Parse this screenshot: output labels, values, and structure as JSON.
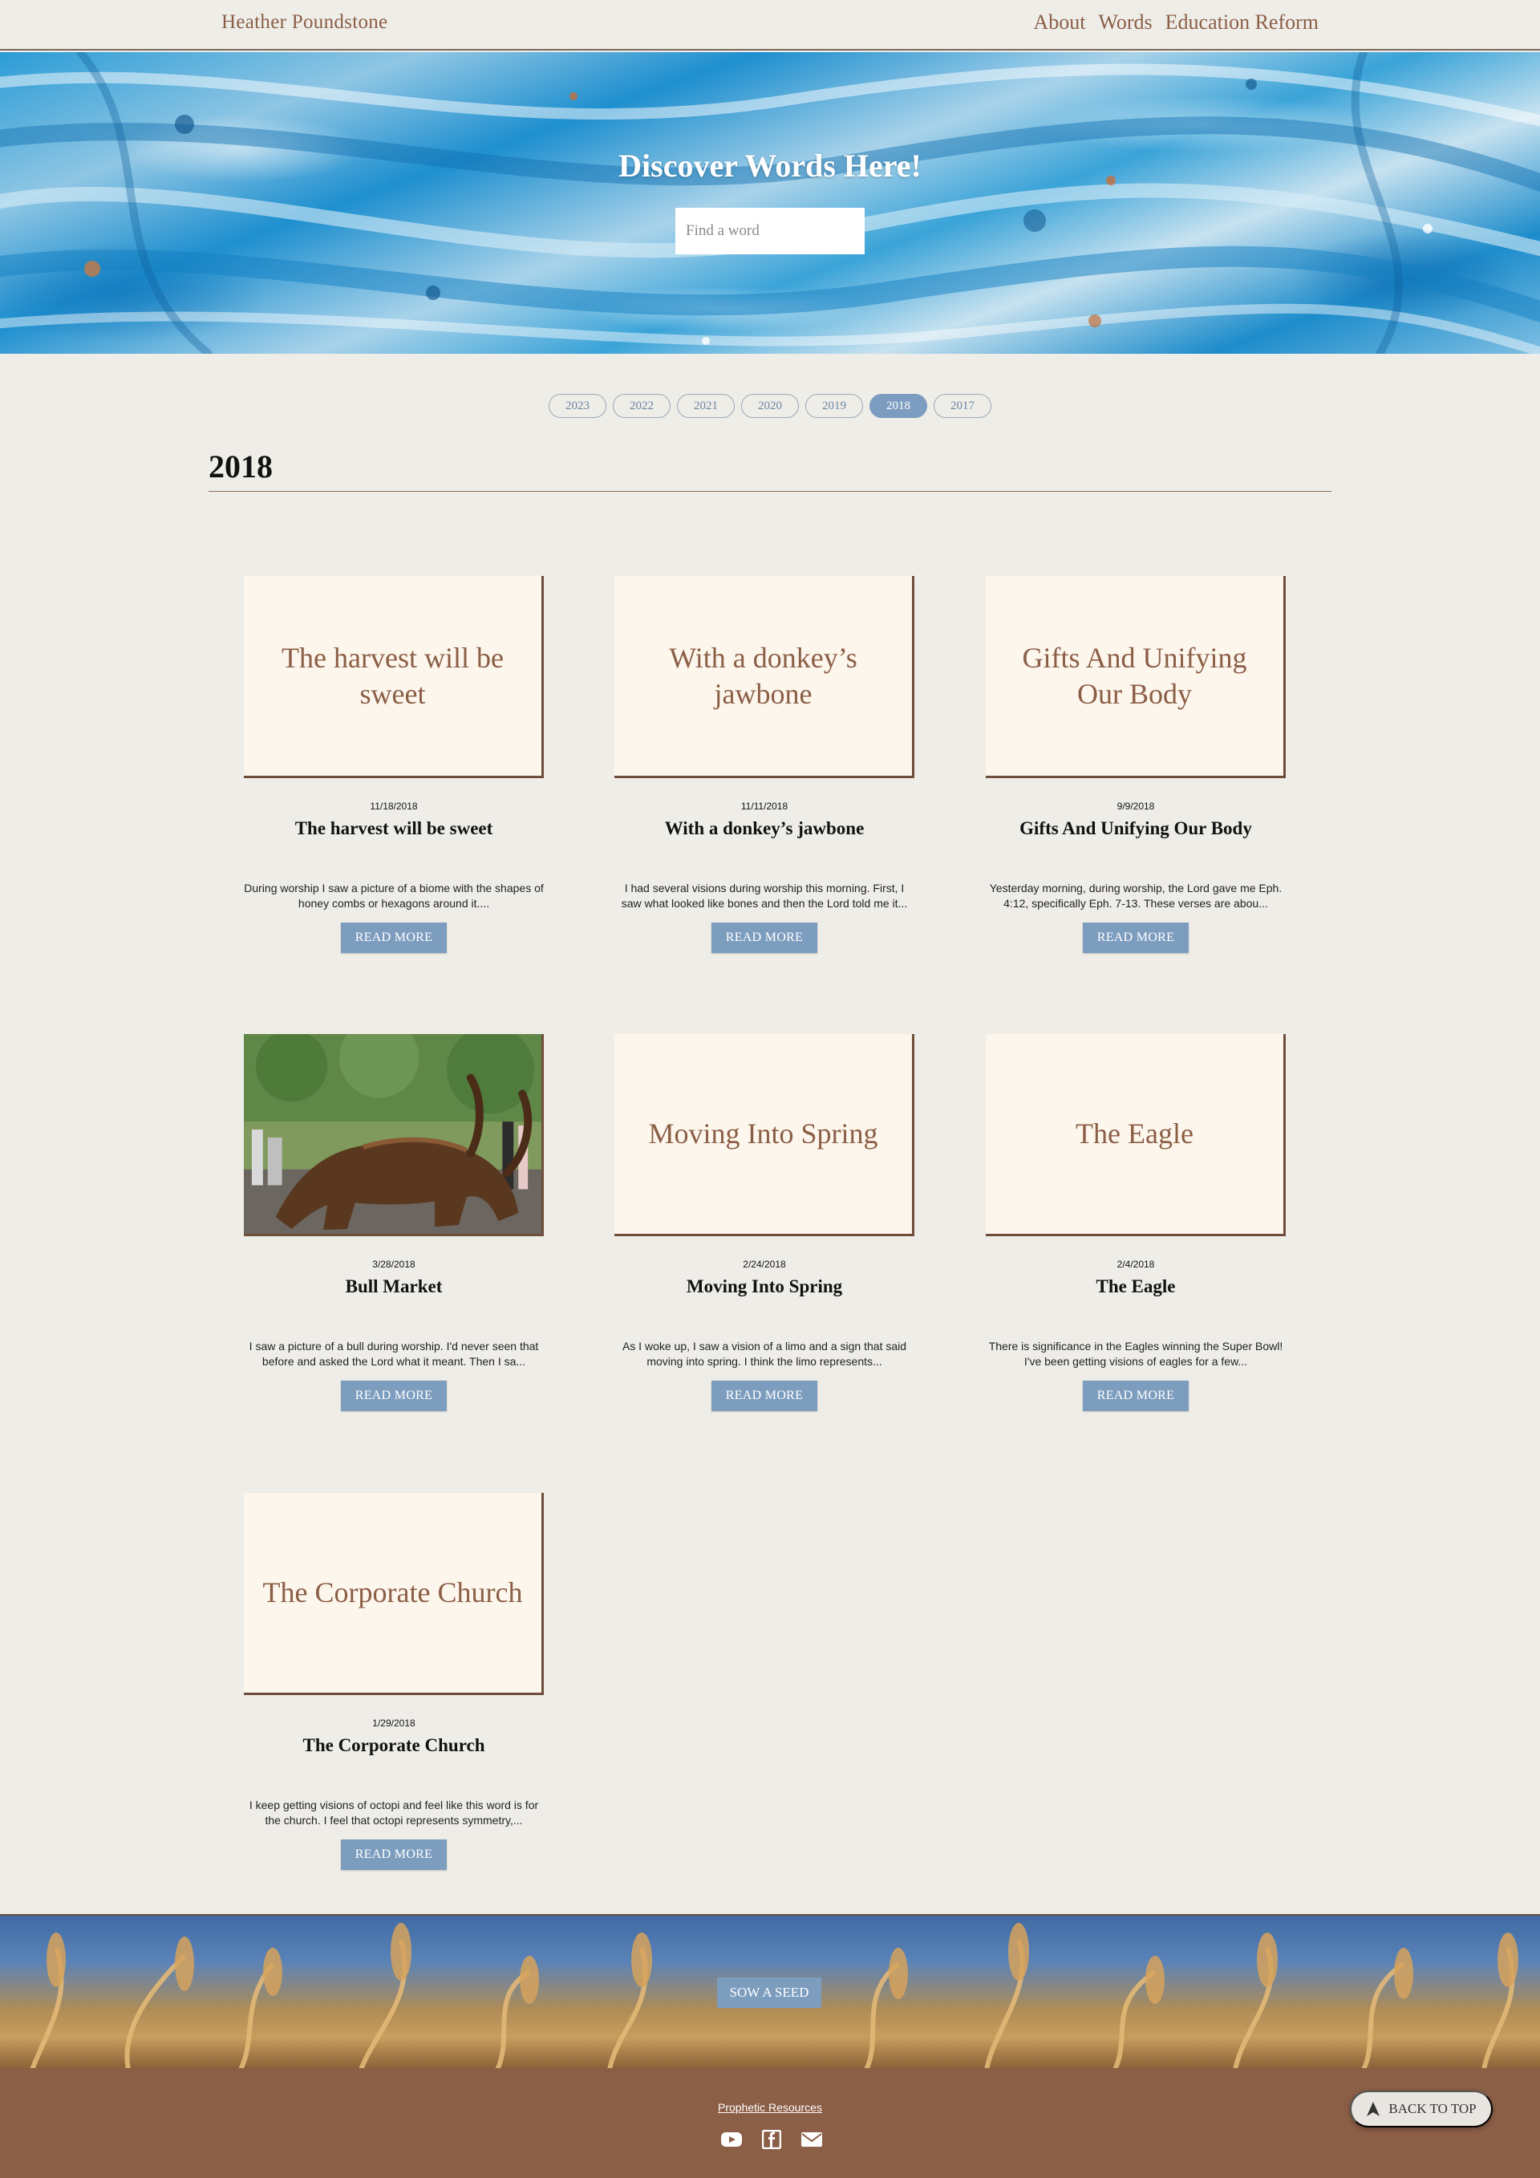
{
  "header": {
    "brand": "Heather Poundstone",
    "nav": [
      "About",
      "Words",
      "Education Reform"
    ]
  },
  "hero": {
    "title": "Discover Words Here!",
    "search_placeholder": "Find a word"
  },
  "years": {
    "options": [
      "2023",
      "2022",
      "2021",
      "2020",
      "2019",
      "2018",
      "2017"
    ],
    "selected": "2018"
  },
  "section": {
    "heading": "2018"
  },
  "posts": [
    {
      "thumb_title": "The harvest will be sweet",
      "date": "11/18/2018",
      "title": "The harvest will be sweet",
      "excerpt": "During worship I saw a picture of a biome with the shapes of honey combs or hexagons around it....",
      "button": "READ MORE"
    },
    {
      "thumb_title": "With a donkey’s jawbone",
      "date": "11/11/2018",
      "title": "With a donkey’s jawbone",
      "excerpt": "I had several visions during worship this morning. First, I saw what looked like bones and then the Lord told me it...",
      "button": "READ MORE"
    },
    {
      "thumb_title": "Gifts And Unifying Our Body",
      "date": "9/9/2018",
      "title": "Gifts And Unifying Our Body",
      "excerpt": "Yesterday morning, during worship, the Lord gave me Eph. 4:12, specifically Eph. 7-13. These verses are abou...",
      "button": "READ MORE"
    },
    {
      "thumb_title": "",
      "image": "bull-statue-photo",
      "date": "3/28/2018",
      "title": "Bull Market",
      "excerpt": "I saw a picture of a bull during worship. I'd never seen that before and asked the Lord what it meant. Then I sa...",
      "button": "READ MORE"
    },
    {
      "thumb_title": "Moving Into Spring",
      "date": "2/24/2018",
      "title": "Moving Into Spring",
      "excerpt": "As I woke up, I saw a vision of a limo and a sign that said moving into spring. I think the limo represents...",
      "button": "READ MORE"
    },
    {
      "thumb_title": "The Eagle",
      "date": "2/4/2018",
      "title": "The Eagle",
      "excerpt": "There is significance in the Eagles winning the Super Bowl! I've been getting visions of eagles for a few...",
      "button": "READ MORE"
    },
    {
      "thumb_title": "The Corporate Church",
      "date": "1/29/2018",
      "title": "The Corporate Church",
      "excerpt": "I keep getting visions of octopi and feel like this word is for the church. I feel that octopi represents symmetry,...",
      "button": "READ MORE"
    }
  ],
  "banner": {
    "button": "SOW A SEED"
  },
  "footer": {
    "link": "Prophetic Resources",
    "socials": [
      "youtube-icon",
      "facebook-icon",
      "email-icon"
    ],
    "back_to_top": "BACK TO TOP"
  },
  "colors": {
    "accent_brown": "#8b5e46",
    "button_blue": "#7d9dbf",
    "card_bg": "#fdf6ec",
    "page_bg": "#efede8"
  }
}
